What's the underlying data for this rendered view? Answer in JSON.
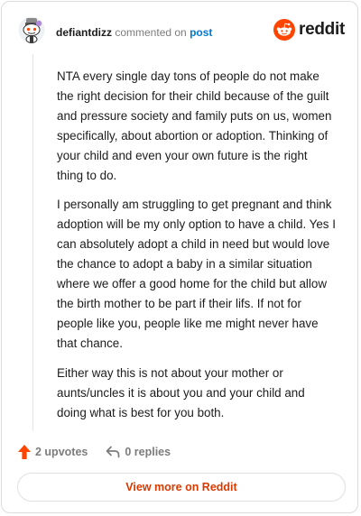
{
  "header": {
    "author": "defiantdizz",
    "action": "commented on",
    "post_link": "post",
    "avatar_icon": "snoo-avatar-icon"
  },
  "brand": {
    "icon": "reddit-snoo-icon",
    "wordmark": "reddit",
    "color": "#ff4500"
  },
  "comment": {
    "paragraphs": [
      "NTA every single day tons of people do not make the right decision for their child because of the guilt and pressure society and family puts on us, women specifically, about abortion or adoption. Thinking of your child and even your own future is the right thing to do.",
      "I personally am struggling to get pregnant and think adoption will be my only option to have a child. Yes I can absolutely adopt a child in need but would love the chance to adopt a baby in a similar situation where we offer a good home for the child but allow the birth mother to be part if their lifs. If not for people like you, people like me might never have that chance.",
      "Either way this is not about your mother or aunts/uncles it is about you and your child and doing what is best for you both."
    ]
  },
  "meta": {
    "upvotes": "2 upvotes",
    "upvote_icon": "upvote-arrow-icon",
    "replies": "0 replies",
    "reply_icon": "reply-arrow-icon",
    "upvote_color": "#ff4500"
  },
  "cta": {
    "label": "View more on Reddit",
    "color": "#d93a00"
  }
}
